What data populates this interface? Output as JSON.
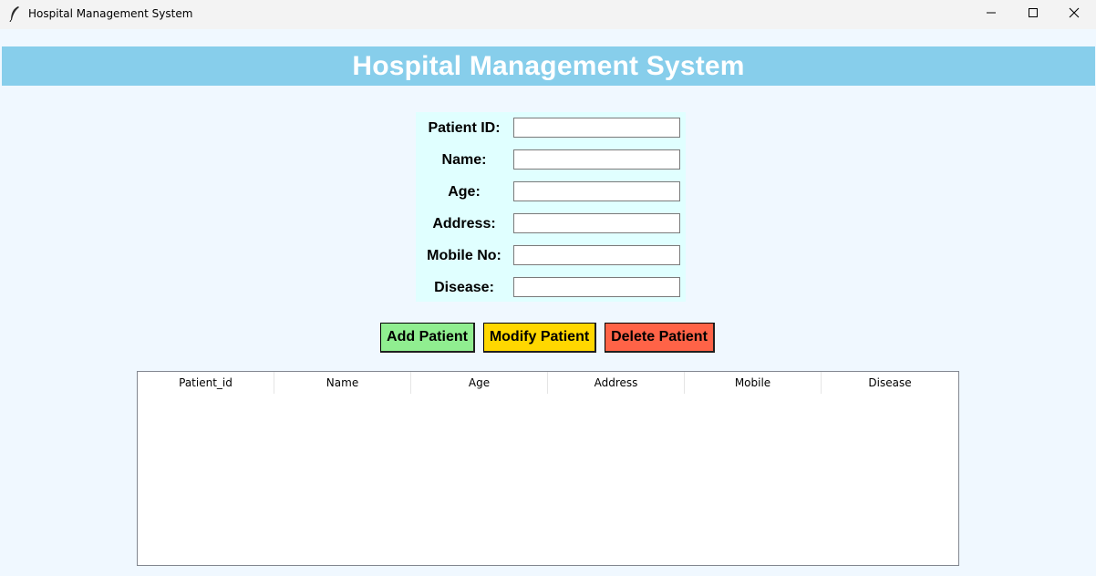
{
  "window": {
    "title": "Hospital Management System",
    "icon": "feather-icon",
    "controls": [
      "minimize-icon",
      "maximize-icon",
      "close-icon"
    ]
  },
  "header": {
    "title": "Hospital Management System",
    "background": "#87ceeb",
    "color": "#ffffff"
  },
  "form": {
    "fields": [
      {
        "label": "Patient ID:",
        "value": ""
      },
      {
        "label": "Name:",
        "value": ""
      },
      {
        "label": "Age:",
        "value": ""
      },
      {
        "label": "Address:",
        "value": ""
      },
      {
        "label": "Mobile No:",
        "value": ""
      },
      {
        "label": "Disease:",
        "value": ""
      }
    ],
    "background": "#e0ffff"
  },
  "actions": {
    "add": {
      "label": "Add Patient",
      "color": "#90ee90"
    },
    "modify": {
      "label": "Modify Patient",
      "color": "#ffd700"
    },
    "delete": {
      "label": "Delete Patient",
      "color": "#ff6347"
    }
  },
  "table": {
    "columns": [
      "Patient_id",
      "Name",
      "Age",
      "Address",
      "Mobile",
      "Disease"
    ],
    "rows": []
  },
  "colors": {
    "page_background": "#f0f8ff"
  }
}
